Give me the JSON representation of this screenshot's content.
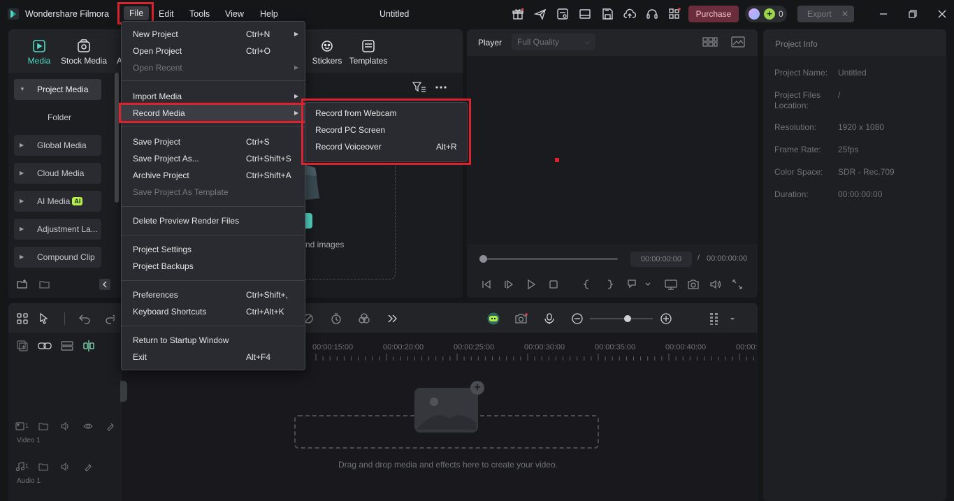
{
  "app": {
    "name": "Wondershare Filmora",
    "document_title": "Untitled"
  },
  "menubar": [
    "File",
    "Edit",
    "Tools",
    "View",
    "Help"
  ],
  "titlebar": {
    "purchase_label": "Purchase",
    "credits": "0",
    "export_label": "Export",
    "export_close": "✕"
  },
  "media_tabs": [
    "Media",
    "Stock Media",
    "A",
    "Stickers",
    "Templates"
  ],
  "sidebar": {
    "items": [
      "Project Media",
      "Global Media",
      "Cloud Media",
      "AI Media",
      "Adjustment La...",
      "Compound Clip"
    ],
    "folder_label": "Folder",
    "ai_badge": "AI"
  },
  "media_content": {
    "drop_text": "nd images"
  },
  "player": {
    "label": "Player",
    "quality": "Full Quality",
    "current_time": "00:00:00:00",
    "separator": "/",
    "total_time": "00:00:00:00"
  },
  "project_info": {
    "title": "Project Info",
    "rows": [
      {
        "label": "Project Name:",
        "value": "Untitled"
      },
      {
        "label": "Project Files Location:",
        "value": "/"
      },
      {
        "label": "Resolution:",
        "value": "1920 x 1080"
      },
      {
        "label": "Frame Rate:",
        "value": "25fps"
      },
      {
        "label": "Color Space:",
        "value": "SDR - Rec.709"
      },
      {
        "label": "Duration:",
        "value": "00:00:00:00"
      }
    ]
  },
  "timeline": {
    "ruler": [
      "00:00:15:00",
      "00:00:20:00",
      "00:00:25:00",
      "00:00:30:00",
      "00:00:35:00",
      "00:00:40:00",
      "00:00:"
    ],
    "hint": "Drag and drop media and effects here to create your video.",
    "tracks": [
      {
        "num": "1",
        "label": "Video 1"
      },
      {
        "num": "1",
        "label": "Audio 1"
      }
    ]
  },
  "file_menu": {
    "items": [
      {
        "label": "New Project",
        "shortcut": "Ctrl+N",
        "submenu": true,
        "disabled": false
      },
      {
        "label": "Open Project",
        "shortcut": "Ctrl+O",
        "submenu": false,
        "disabled": false
      },
      {
        "label": "Open Recent",
        "shortcut": "",
        "submenu": true,
        "disabled": true
      },
      {
        "label": "Import Media",
        "shortcut": "",
        "submenu": true,
        "disabled": false
      },
      {
        "label": "Record Media",
        "shortcut": "",
        "submenu": true,
        "disabled": false
      },
      {
        "label": "Save Project",
        "shortcut": "Ctrl+S",
        "submenu": false,
        "disabled": false
      },
      {
        "label": "Save Project As...",
        "shortcut": "Ctrl+Shift+S",
        "submenu": false,
        "disabled": false
      },
      {
        "label": "Archive Project",
        "shortcut": "Ctrl+Shift+A",
        "submenu": false,
        "disabled": false
      },
      {
        "label": "Save Project As Template",
        "shortcut": "",
        "submenu": false,
        "disabled": true
      },
      {
        "label": "Delete Preview Render Files",
        "shortcut": "",
        "submenu": false,
        "disabled": false
      },
      {
        "label": "Project Settings",
        "shortcut": "",
        "submenu": false,
        "disabled": false
      },
      {
        "label": "Project Backups",
        "shortcut": "",
        "submenu": false,
        "disabled": false
      },
      {
        "label": "Preferences",
        "shortcut": "Ctrl+Shift+,",
        "submenu": false,
        "disabled": false
      },
      {
        "label": "Keyboard Shortcuts",
        "shortcut": "Ctrl+Alt+K",
        "submenu": false,
        "disabled": false
      },
      {
        "label": "Return to Startup Window",
        "shortcut": "",
        "submenu": false,
        "disabled": false
      },
      {
        "label": "Exit",
        "shortcut": "Alt+F4",
        "submenu": false,
        "disabled": false
      }
    ]
  },
  "record_submenu": {
    "items": [
      {
        "label": "Record from Webcam",
        "shortcut": ""
      },
      {
        "label": "Record PC Screen",
        "shortcut": ""
      },
      {
        "label": "Record Voiceover",
        "shortcut": "Alt+R"
      }
    ]
  },
  "colors": {
    "highlight_box": "#d9232e",
    "accent_teal": "#52d8c3",
    "ai_badge": "#b6f04a",
    "purchase_bg": "#6b2d3c"
  }
}
